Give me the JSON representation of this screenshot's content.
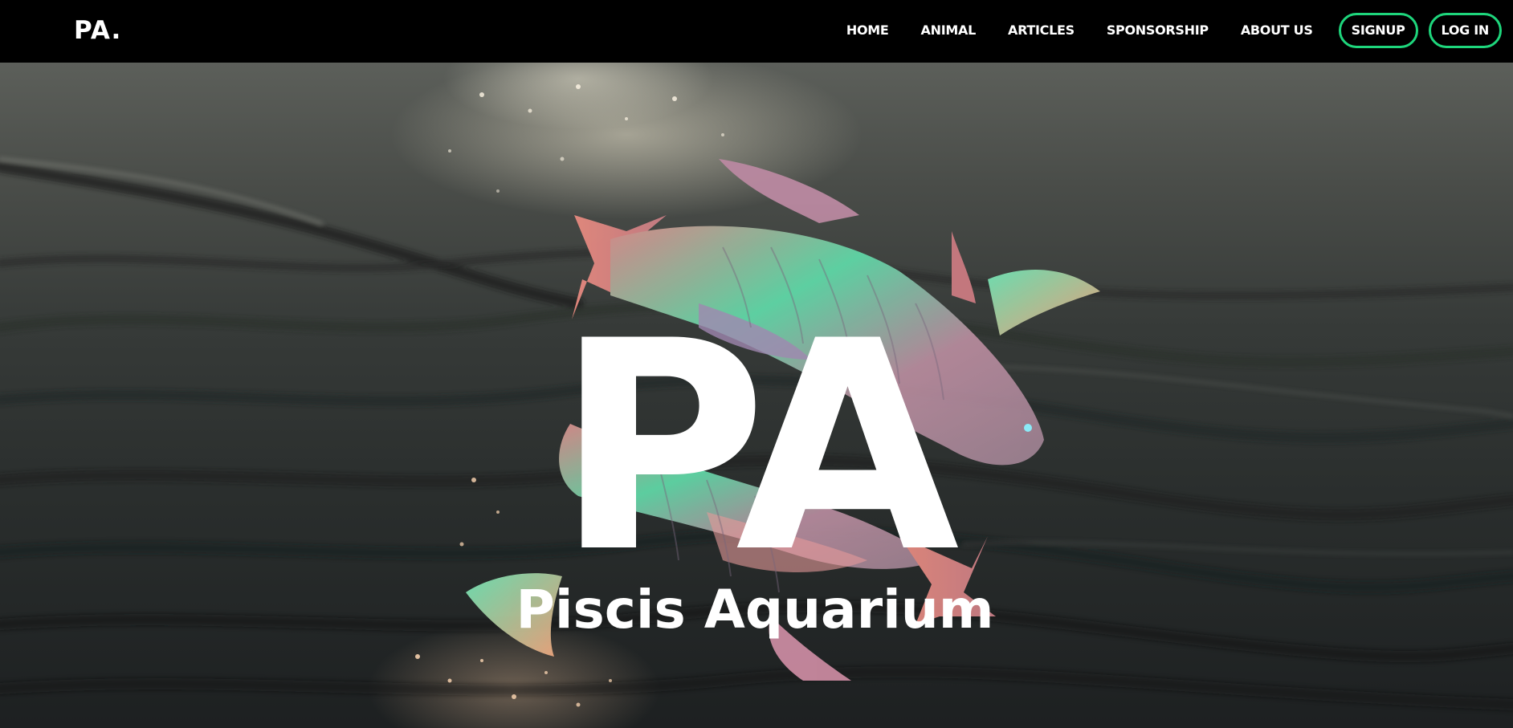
{
  "brand": {
    "logo_text": "PA."
  },
  "nav": {
    "links": [
      {
        "label": "HOME"
      },
      {
        "label": "ANIMAL"
      },
      {
        "label": "ARTICLES"
      },
      {
        "label": "SPONSORSHIP"
      },
      {
        "label": "ABOUT US"
      }
    ],
    "signup_label": "SIGNUP",
    "login_label": "LOG IN"
  },
  "hero": {
    "monogram": "PA",
    "title": "Piscis Aquarium",
    "background_image": "ocean-waves",
    "decoration_image": "parrotfish"
  },
  "colors": {
    "navbar_bg": "#000000",
    "accent": "#1ed67c",
    "text": "#ffffff"
  }
}
